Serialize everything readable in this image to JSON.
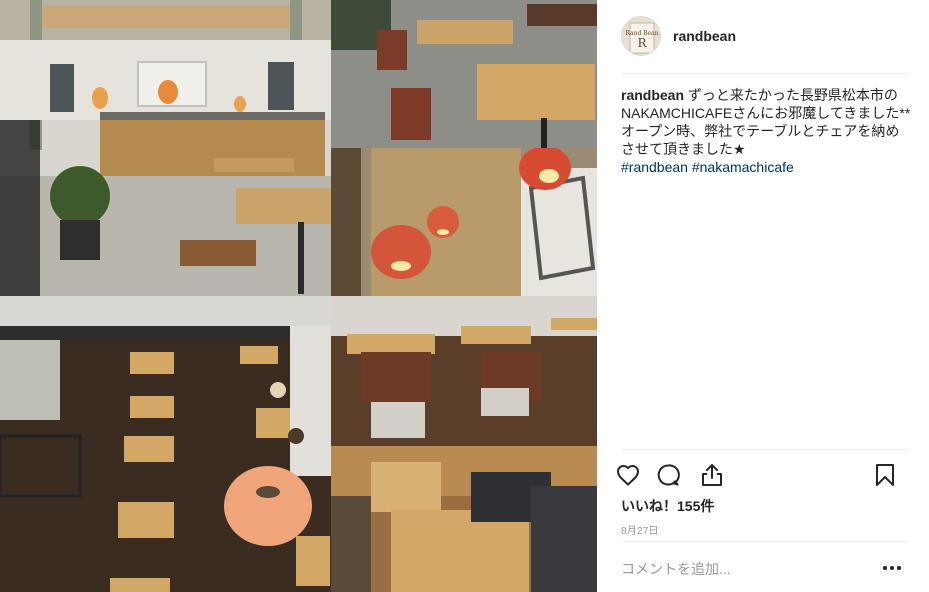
{
  "post": {
    "username": "randbean",
    "avatar_text": "Rand Bean",
    "caption": {
      "username": "randbean",
      "line1": " ずっと来たかった長野県松本市のNAKAMCHICAFEさんにお邪魔してきました**",
      "line2": "オープン時、弊社でテーブルとチェアを納めさせて頂きました★",
      "hashtag1": "#randbean",
      "hashtag2": "#nakamachicafe"
    },
    "likes": "いいね！155件",
    "date": "8月27日",
    "comment_placeholder": "コメントを追加...",
    "more_label": "•••"
  },
  "icons": {
    "like": "heart-icon",
    "comment": "comment-bubble-icon",
    "share": "share-icon",
    "save": "bookmark-icon",
    "more": "more-options-icon"
  },
  "colors": {
    "text": "#262626",
    "hashtag": "#003569",
    "muted": "#999999",
    "divider": "#efefef"
  }
}
